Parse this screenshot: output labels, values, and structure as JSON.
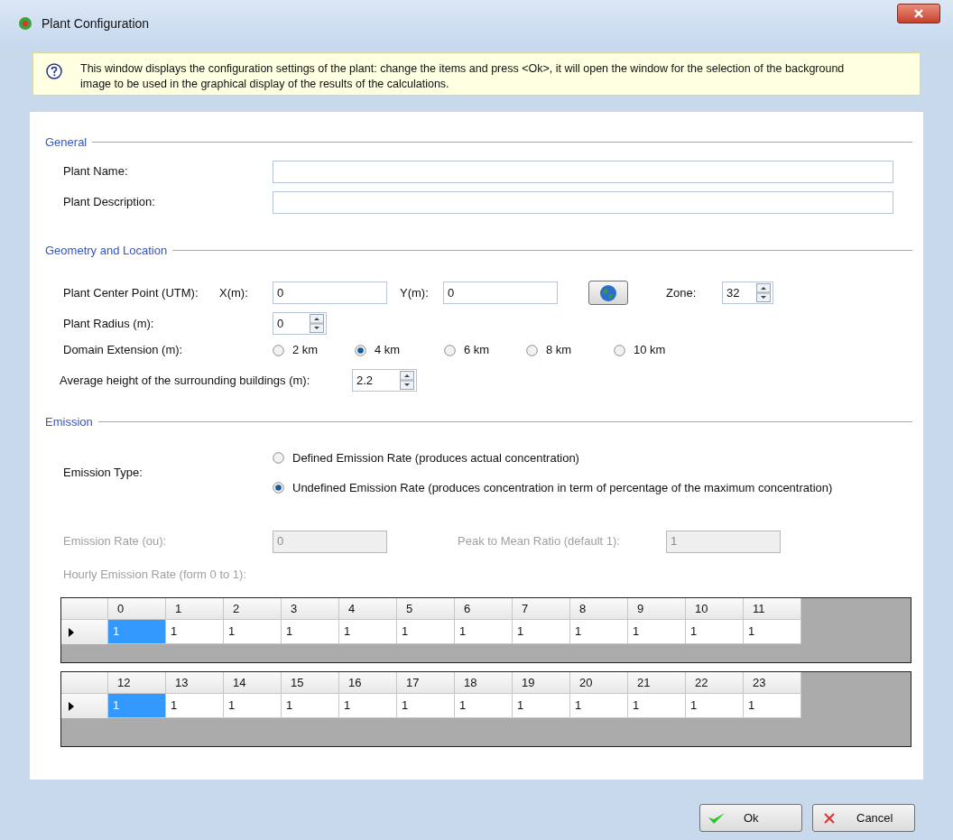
{
  "window": {
    "title": "Plant Configuration"
  },
  "info": {
    "text": "This window displays the configuration settings of the plant: change the items and press <Ok>, it will open the window for the selection of the background image to be used in the graphical display of the results of the calculations."
  },
  "general": {
    "legend": "General",
    "name_label": "Plant Name:",
    "description_label": "Plant  Description:"
  },
  "geometry": {
    "legend": "Geometry and Location",
    "center_label": "Plant Center Point (UTM):",
    "x_label": "X(m):",
    "x_value": "0",
    "y_label": "Y(m):",
    "y_value": "0",
    "zone_label": "Zone:",
    "zone_value": "32",
    "radius_label": "Plant Radius (m):",
    "radius_value": "0",
    "domain_label": "Domain Extension (m):",
    "domain_options": [
      {
        "label": "2 km",
        "selected": false
      },
      {
        "label": "4 km",
        "selected": true
      },
      {
        "label": "6 km",
        "selected": false
      },
      {
        "label": "8 km",
        "selected": false
      },
      {
        "label": "10 km",
        "selected": false
      }
    ],
    "height_label": "Average height of the surrounding buildings (m):",
    "height_value": "2.2"
  },
  "emission": {
    "legend": "Emission",
    "type_label": "Emission Type:",
    "type_options": [
      {
        "label": "Defined Emission Rate (produces actual concentration)",
        "selected": false
      },
      {
        "label": "Undefined Emission Rate (produces concentration in term of percentage of the maximum concentration)",
        "selected": true
      }
    ],
    "rate_label": "Emission Rate (ou):",
    "rate_value": "0",
    "peak_label": "Peak to Mean Ratio (default 1):",
    "peak_value": "1",
    "hourly_label": "Hourly Emission Rate (form 0 to 1):",
    "disabled": true
  },
  "grids": [
    {
      "columns": [
        "0",
        "1",
        "2",
        "3",
        "4",
        "5",
        "6",
        "7",
        "8",
        "9",
        "10",
        "11"
      ],
      "cells": [
        {
          "value": "1",
          "selected": true
        },
        {
          "value": "1",
          "selected": false
        },
        {
          "value": "1",
          "selected": false
        },
        {
          "value": "1",
          "selected": false
        },
        {
          "value": "1",
          "selected": false
        },
        {
          "value": "1",
          "selected": false
        },
        {
          "value": "1",
          "selected": false
        },
        {
          "value": "1",
          "selected": false
        },
        {
          "value": "1",
          "selected": false
        },
        {
          "value": "1",
          "selected": false
        },
        {
          "value": "1",
          "selected": false
        },
        {
          "value": "1",
          "selected": false
        }
      ]
    },
    {
      "columns": [
        "12",
        "13",
        "14",
        "15",
        "16",
        "17",
        "18",
        "19",
        "20",
        "21",
        "22",
        "23"
      ],
      "cells": [
        {
          "value": "1",
          "selected": true
        },
        {
          "value": "1",
          "selected": false
        },
        {
          "value": "1",
          "selected": false
        },
        {
          "value": "1",
          "selected": false
        },
        {
          "value": "1",
          "selected": false
        },
        {
          "value": "1",
          "selected": false
        },
        {
          "value": "1",
          "selected": false
        },
        {
          "value": "1",
          "selected": false
        },
        {
          "value": "1",
          "selected": false
        },
        {
          "value": "1",
          "selected": false
        },
        {
          "value": "1",
          "selected": false
        },
        {
          "value": "1",
          "selected": false
        }
      ]
    }
  ],
  "buttons": [
    {
      "kind": "ok",
      "label": "Ok"
    },
    {
      "kind": "cancel",
      "label": "Cancel"
    }
  ]
}
